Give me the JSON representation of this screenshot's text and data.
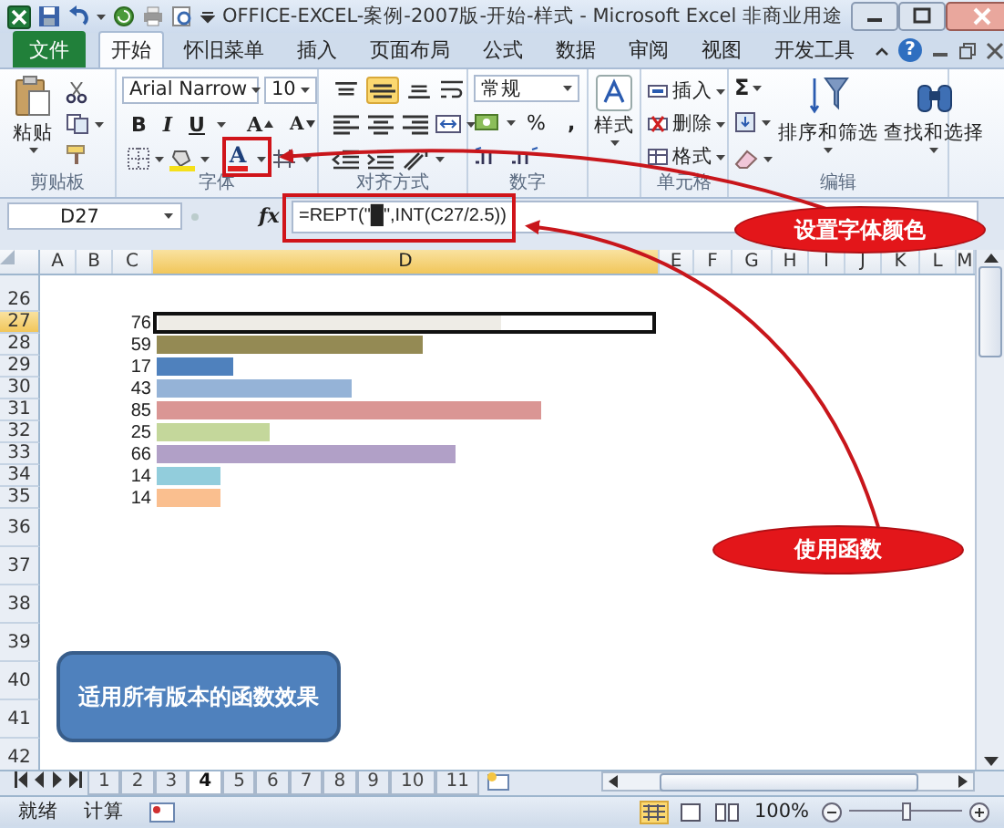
{
  "window": {
    "title": "OFFICE-EXCEL-案例-2007版-开始-样式 - Microsoft Excel 非商业用途"
  },
  "ribbon_tabs": [
    {
      "label": "文件",
      "kind": "file"
    },
    {
      "label": "开始",
      "kind": "tab",
      "selected": true
    },
    {
      "label": "怀旧菜单",
      "kind": "tab",
      "selected": false
    },
    {
      "label": "插入",
      "kind": "tab",
      "selected": false
    },
    {
      "label": "页面布局",
      "kind": "tab",
      "selected": false
    },
    {
      "label": "公式",
      "kind": "tab",
      "selected": false
    },
    {
      "label": "数据",
      "kind": "tab",
      "selected": false
    },
    {
      "label": "审阅",
      "kind": "tab",
      "selected": false
    },
    {
      "label": "视图",
      "kind": "tab",
      "selected": false
    },
    {
      "label": "开发工具",
      "kind": "tab",
      "selected": false
    }
  ],
  "help": "?",
  "ribbon": {
    "clipboard": {
      "label": "剪贴板",
      "paste": "粘贴"
    },
    "font": {
      "label": "字体",
      "font_name": "Arial Narrow",
      "font_size": "10",
      "bold": "B",
      "italic": "I",
      "underline": "U",
      "grow": "A",
      "shrink": "A",
      "font_color": "A"
    },
    "alignment": {
      "label": "对齐方式",
      "vertical": [
        {
          "selected": false
        },
        {
          "selected": true
        },
        {
          "selected": false
        }
      ]
    },
    "number": {
      "label": "数字",
      "format": "常规",
      "percent": "%",
      "comma": ","
    },
    "styles": {
      "button": "样式"
    },
    "cells": {
      "label": "单元格",
      "items": [
        "插入",
        "删除",
        "格式"
      ]
    },
    "editing": {
      "label": "编辑",
      "sum": "Σ",
      "sort": "排序和筛选",
      "find": "查找和选择"
    }
  },
  "formula_bar": {
    "name_box": "D27",
    "fx": "fx",
    "formula": "=REPT(\"█\",INT(C27/2.5))"
  },
  "columns": [
    {
      "label": "A",
      "selected": false
    },
    {
      "label": "B",
      "selected": false
    },
    {
      "label": "C",
      "selected": false
    },
    {
      "label": "D",
      "selected": true
    },
    {
      "label": "E",
      "selected": false
    },
    {
      "label": "F",
      "selected": false
    },
    {
      "label": "G",
      "selected": false
    },
    {
      "label": "H",
      "selected": false
    },
    {
      "label": "I",
      "selected": false
    },
    {
      "label": "J",
      "selected": false
    },
    {
      "label": "K",
      "selected": false
    },
    {
      "label": "L",
      "selected": false
    },
    {
      "label": "M",
      "selected": false
    }
  ],
  "rows": [
    {
      "number": "26",
      "selected": false
    },
    {
      "number": "27",
      "selected": true,
      "value": "76",
      "color": "#eeece6"
    },
    {
      "number": "28",
      "selected": false,
      "value": "59",
      "color": "#948a54"
    },
    {
      "number": "29",
      "selected": false,
      "value": "17",
      "color": "#4f81bd"
    },
    {
      "number": "30",
      "selected": false,
      "value": "43",
      "color": "#95b3d7"
    },
    {
      "number": "31",
      "selected": false,
      "value": "85",
      "color": "#da9694"
    },
    {
      "number": "32",
      "selected": false,
      "value": "25",
      "color": "#c4d79b"
    },
    {
      "number": "33",
      "selected": false,
      "value": "66",
      "color": "#b1a0c7"
    },
    {
      "number": "34",
      "selected": false,
      "value": "14",
      "color": "#92cddc"
    },
    {
      "number": "35",
      "selected": false,
      "value": "14",
      "color": "#fabf8f"
    },
    {
      "number": "36",
      "selected": false
    },
    {
      "number": "37",
      "selected": false
    },
    {
      "number": "38",
      "selected": false
    },
    {
      "number": "39",
      "selected": false
    },
    {
      "number": "40",
      "selected": false
    },
    {
      "number": "41",
      "selected": false
    },
    {
      "number": "42",
      "selected": false
    }
  ],
  "sheet_tabs": [
    {
      "label": "1",
      "selected": false
    },
    {
      "label": "2",
      "selected": false
    },
    {
      "label": "3",
      "selected": false
    },
    {
      "label": "4",
      "selected": true
    },
    {
      "label": "5",
      "selected": false
    },
    {
      "label": "6",
      "selected": false
    },
    {
      "label": "7",
      "selected": false
    },
    {
      "label": "8",
      "selected": false
    },
    {
      "label": "9",
      "selected": false
    },
    {
      "label": "10",
      "selected": false
    },
    {
      "label": "11",
      "selected": false
    }
  ],
  "status_bar": {
    "ready": "就绪",
    "calc": "计算",
    "views": [
      {
        "selected": true
      },
      {
        "selected": false
      },
      {
        "selected": false
      }
    ],
    "zoom": "100%",
    "zoom_slider": {
      "level": 0.5
    }
  },
  "callouts": [
    {
      "text": "设置字体颜色"
    },
    {
      "text": "使用函数"
    }
  ],
  "note": "适用所有版本的函数效果"
}
